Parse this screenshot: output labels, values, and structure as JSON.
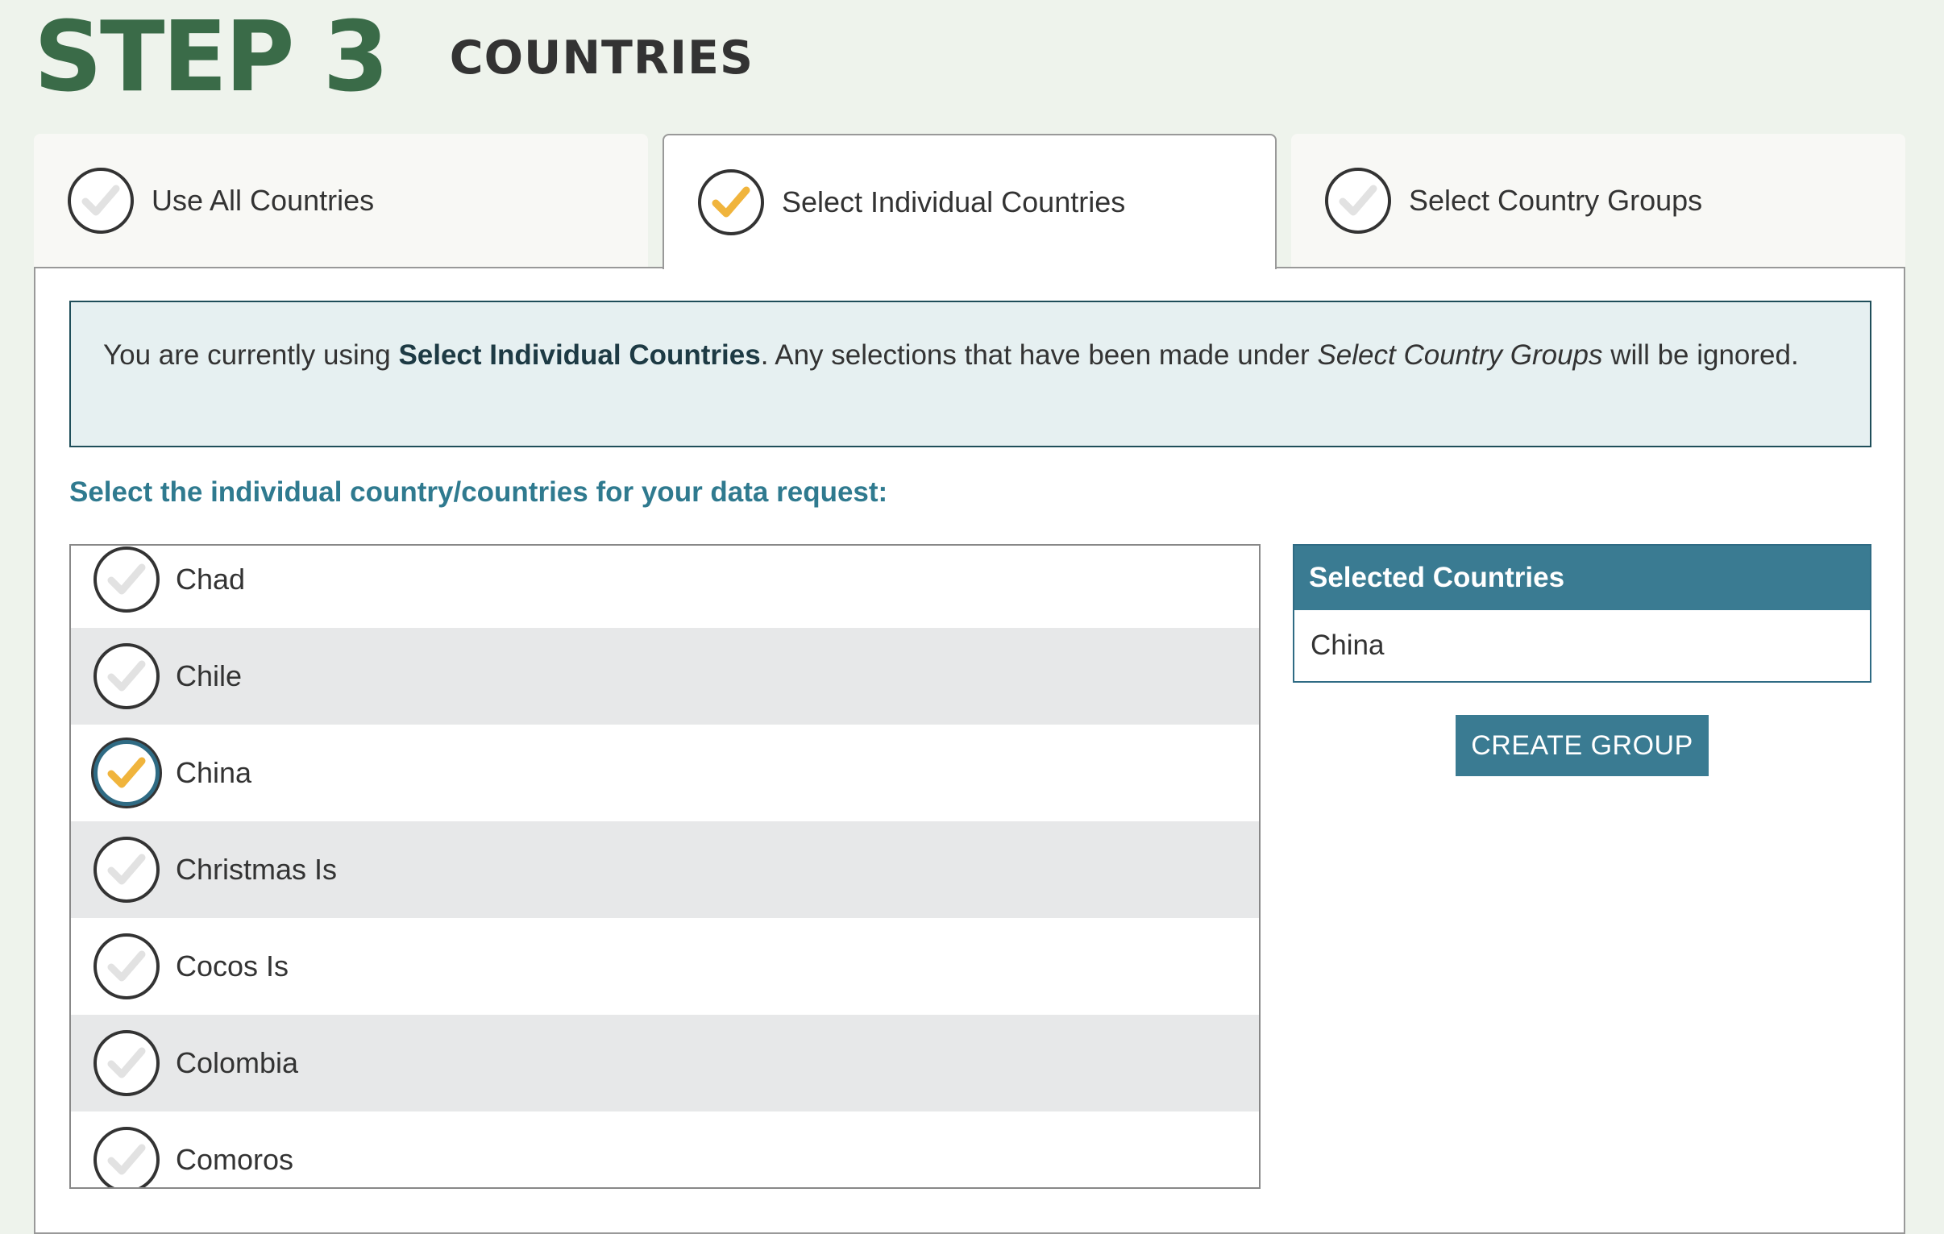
{
  "header": {
    "step": "STEP 3",
    "title": "COUNTRIES"
  },
  "tabs": [
    {
      "label": "Use All Countries",
      "selected": false
    },
    {
      "label": "Select Individual Countries",
      "selected": true
    },
    {
      "label": "Select Country Groups",
      "selected": false
    }
  ],
  "info": {
    "prefix": "You are currently using ",
    "active_mode": "Select Individual Countries",
    "middle": ". Any selections that have been made under ",
    "ignored_mode": "Select Country Groups",
    "suffix": " will be ignored."
  },
  "instruction": "Select the individual country/countries for your data request:",
  "countries": [
    {
      "label": "Chad",
      "selected": false
    },
    {
      "label": "Chile",
      "selected": false
    },
    {
      "label": "China",
      "selected": true
    },
    {
      "label": "Christmas Is",
      "selected": false
    },
    {
      "label": "Cocos Is",
      "selected": false
    },
    {
      "label": "Colombia",
      "selected": false
    },
    {
      "label": "Comoros",
      "selected": false
    }
  ],
  "selected_panel": {
    "title": "Selected Countries",
    "items": [
      "China"
    ]
  },
  "create_group_label": "CREATE GROUP",
  "colors": {
    "step_green": "#3a6b48",
    "accent_teal": "#3a7b92",
    "check_selected": "#f0b43c",
    "check_unselected": "#e2e2e2"
  }
}
